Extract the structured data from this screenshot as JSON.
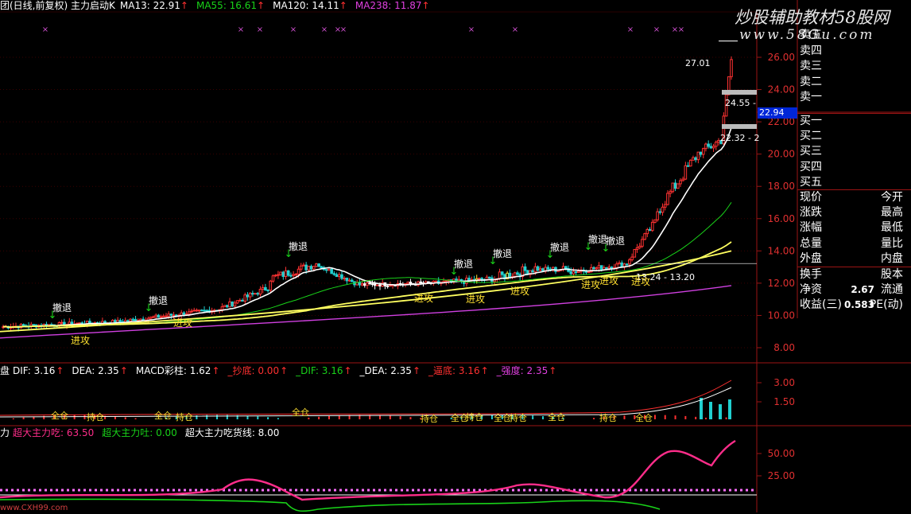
{
  "header": {
    "title": "团(日线,前复权) 主力启动K",
    "ma": [
      {
        "label": "MA13: 22.91",
        "color": "#ffffff"
      },
      {
        "label": "MA55: 16.61",
        "color": "#19d219"
      },
      {
        "label": "MA120: 14.11",
        "color": "#ffffff"
      },
      {
        "label": "MA238: 11.87",
        "color": "#e040e0"
      }
    ],
    "arrow": "↑"
  },
  "watermark": {
    "line1": "炒股辅助教材58股网",
    "line2": "www.58Gu.com"
  },
  "price_axis": [
    "26.00",
    "24.00",
    "22.00",
    "20.00",
    "18.00",
    "16.00",
    "14.00",
    "12.00",
    "10.00",
    "8.00"
  ],
  "price_tag": "22.94",
  "annotations": {
    "high": "27.01",
    "mid_upper": "24.55 -",
    "mid_lower": "22.32 - 2",
    "range": "13.24 - 13.20"
  },
  "signals": {
    "retreat": "撤退",
    "attack": "进攻",
    "fill": "全仓",
    "hold": "持仓"
  },
  "orderbook": {
    "sells": [
      "卖五",
      "卖四",
      "卖三",
      "卖二",
      "卖一"
    ],
    "buys": [
      "买一",
      "买二",
      "买三",
      "买四",
      "买五"
    ],
    "quote": [
      {
        "l": "现价",
        "v": "",
        "r": "今开"
      },
      {
        "l": "涨跌",
        "v": "",
        "r": "最高"
      },
      {
        "l": "涨幅",
        "v": "",
        "r": "最低"
      },
      {
        "l": "总量",
        "v": "",
        "r": "量比"
      },
      {
        "l": "外盘",
        "v": "",
        "r": "内盘"
      }
    ],
    "stats": [
      {
        "l": "换手",
        "v": "",
        "r": "股本"
      },
      {
        "l": "净资",
        "v": "2.67",
        "r": "流通"
      },
      {
        "l": "收益(三)",
        "v": "0.583",
        "r": "PE(动)"
      }
    ]
  },
  "macd_panel": {
    "prefix": "盘",
    "items": [
      {
        "label": "DIF: 3.16",
        "color": "#ffffff"
      },
      {
        "label": "DEA: 2.35",
        "color": "#ffffff"
      },
      {
        "label": "MACD彩柱: 1.62",
        "color": "#ffffff"
      },
      {
        "label": "_抄底: 0.00",
        "color": "#ff3030"
      },
      {
        "label": "_DIF: 3.16",
        "color": "#19d219"
      },
      {
        "label": "_DEA: 2.35",
        "color": "#ffffff"
      },
      {
        "label": "_逼底: 3.16",
        "color": "#ff3030"
      },
      {
        "label": "_强度: 2.35",
        "color": "#e040e0"
      }
    ],
    "axis": [
      "3.00",
      "1.50"
    ]
  },
  "power_panel": {
    "prefix": "力",
    "items": [
      {
        "label": "超大主力吃: 63.50",
        "color": "#ff2d8a"
      },
      {
        "label": "超大主力吐: 0.00",
        "color": "#19d219"
      },
      {
        "label": "超大主力吃货线: 8.00",
        "color": "#ffffff"
      }
    ],
    "axis": [
      "50.00",
      "25.00"
    ],
    "footer": "www.CXH99.com"
  },
  "chart_data": {
    "type": "candlestick",
    "ylim": [
      7,
      28
    ],
    "note": "synthetic price path approximating shown chart",
    "ma": {
      "MA13": 22.91,
      "MA55": 16.61,
      "MA120": 14.11,
      "MA238": 11.87
    }
  }
}
